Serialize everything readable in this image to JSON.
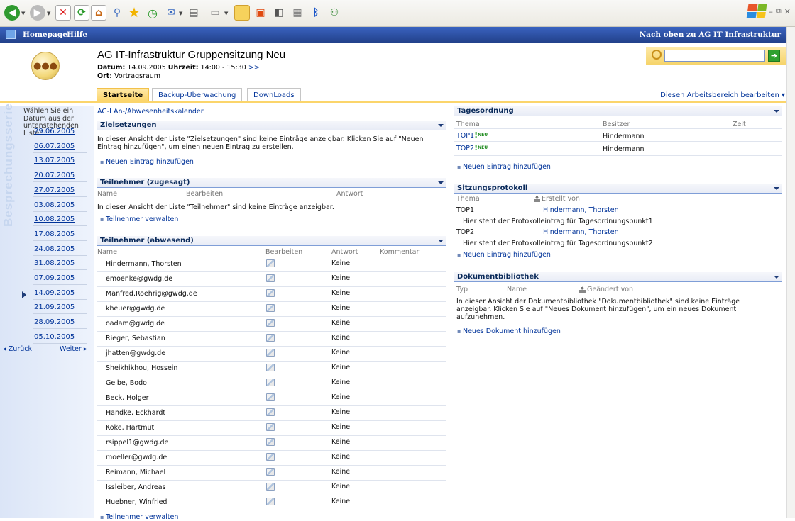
{
  "top_bar": {
    "home": "Homepage",
    "help": "Hilfe",
    "up_link": "Nach oben zu AG IT Infrastruktur"
  },
  "header": {
    "title": "AG IT-Infrastruktur Gruppensitzung Neu",
    "date_label": "Datum:",
    "date_value": "14.09.2005",
    "time_label": "Uhrzeit:",
    "time_value": "14:00 - 15:30",
    "more": ">>",
    "location_label": "Ort:",
    "location_value": "Vortragsraum"
  },
  "search": {
    "value": ""
  },
  "tabs": [
    {
      "label": "Startseite",
      "active": true
    },
    {
      "label": "Backup-Überwachung",
      "active": false
    },
    {
      "label": "DownLoads",
      "active": false
    }
  ],
  "edit_workspace": "Diesen Arbeitsbereich bearbeiten ▾",
  "left_nav": {
    "vertical_label": "Besprechungsserie",
    "intro": "Wählen Sie ein Datum aus der untenstehenden Liste:",
    "dates": [
      "29.06.2005",
      "06.07.2005",
      "13.07.2005",
      "20.07.2005",
      "27.07.2005",
      "03.08.2005",
      "10.08.2005",
      "17.08.2005",
      "24.08.2005",
      "31.08.2005",
      "07.09.2005",
      "14.09.2005",
      "21.09.2005",
      "28.09.2005",
      "05.10.2005"
    ],
    "selected": "14.09.2005",
    "back": "◂ Zurück",
    "forward": "Weiter ▸"
  },
  "calendar_link": "AG-I An-/Abwesenheitskalender",
  "zielsetzungen": {
    "title": "Zielsetzungen",
    "empty": "In dieser Ansicht der Liste \"Zielsetzungen\" sind keine Einträge anzeigbar. Klicken Sie auf \"Neuen Eintrag hinzufügen\", um einen neuen Eintrag zu erstellen.",
    "add": "Neuen Eintrag hinzufügen"
  },
  "teilnehmer_zugesagt": {
    "title": "Teilnehmer (zugesagt)",
    "columns": [
      "Name",
      "Bearbeiten",
      "Antwort"
    ],
    "empty": "In dieser Ansicht der Liste \"Teilnehmer\" sind keine Einträge anzeigbar.",
    "manage": "Teilnehmer verwalten"
  },
  "teilnehmer_abwesend": {
    "title": "Teilnehmer (abwesend)",
    "columns": [
      "Name",
      "Bearbeiten",
      "Antwort",
      "Kommentar"
    ],
    "rows": [
      {
        "name": "Hindermann, Thorsten",
        "answer": "Keine"
      },
      {
        "name": "emoenke@gwdg.de",
        "answer": "Keine"
      },
      {
        "name": "Manfred.Roehrig@gwdg.de",
        "answer": "Keine"
      },
      {
        "name": "kheuer@gwdg.de",
        "answer": "Keine"
      },
      {
        "name": "oadam@gwdg.de",
        "answer": "Keine"
      },
      {
        "name": "Rieger, Sebastian",
        "answer": "Keine"
      },
      {
        "name": "jhatten@gwdg.de",
        "answer": "Keine"
      },
      {
        "name": "Sheikhikhou, Hossein",
        "answer": "Keine"
      },
      {
        "name": "Gelbe, Bodo",
        "answer": "Keine"
      },
      {
        "name": "Beck, Holger",
        "answer": "Keine"
      },
      {
        "name": "Handke, Eckhardt",
        "answer": "Keine"
      },
      {
        "name": "Koke, Hartmut",
        "answer": "Keine"
      },
      {
        "name": "rsippel1@gwdg.de",
        "answer": "Keine"
      },
      {
        "name": "moeller@gwdg.de",
        "answer": "Keine"
      },
      {
        "name": "Reimann, Michael",
        "answer": "Keine"
      },
      {
        "name": "Issleiber, Andreas",
        "answer": "Keine"
      },
      {
        "name": "Huebner, Winfried",
        "answer": "Keine"
      }
    ],
    "manage": "Teilnehmer verwalten"
  },
  "tagesordnung": {
    "title": "Tagesordnung",
    "columns": [
      "Thema",
      "Besitzer",
      "Zeit"
    ],
    "rows": [
      {
        "topic": "TOP1",
        "badge": "NEU",
        "owner": "Hindermann"
      },
      {
        "topic": "TOP2",
        "badge": "NEU",
        "owner": "Hindermann"
      }
    ],
    "add": "Neuen Eintrag hinzufügen"
  },
  "sitzungsprotokoll": {
    "title": "Sitzungsprotokoll",
    "columns": [
      "Thema",
      "Erstellt von"
    ],
    "rows": [
      {
        "topic": "TOP1",
        "author": "Hindermann, Thorsten",
        "text": "Hier steht der Protokolleintrag für Tagesordnungspunkt1"
      },
      {
        "topic": "TOP2",
        "author": "Hindermann, Thorsten",
        "text": "Hier steht der Protokolleintrag für Tagesordnungspunkt2"
      }
    ],
    "add": "Neuen Eintrag hinzufügen"
  },
  "dokumentbibliothek": {
    "title": "Dokumentbibliothek",
    "columns": [
      "Typ",
      "Name",
      "Geändert von"
    ],
    "empty": "In dieser Ansicht der Dokumentbibliothek \"Dokumentbibliothek\" sind keine Einträge anzeigbar. Klicken Sie auf \"Neues Dokument hinzufügen\", um ein neues Dokument aufzunehmen.",
    "add": "Neues Dokument hinzufügen"
  },
  "colors": {
    "bar_blue": "#2a4c9c",
    "tab_gold": "#fbd56b",
    "link": "#003399",
    "nav_bg": "#e8eefa"
  }
}
